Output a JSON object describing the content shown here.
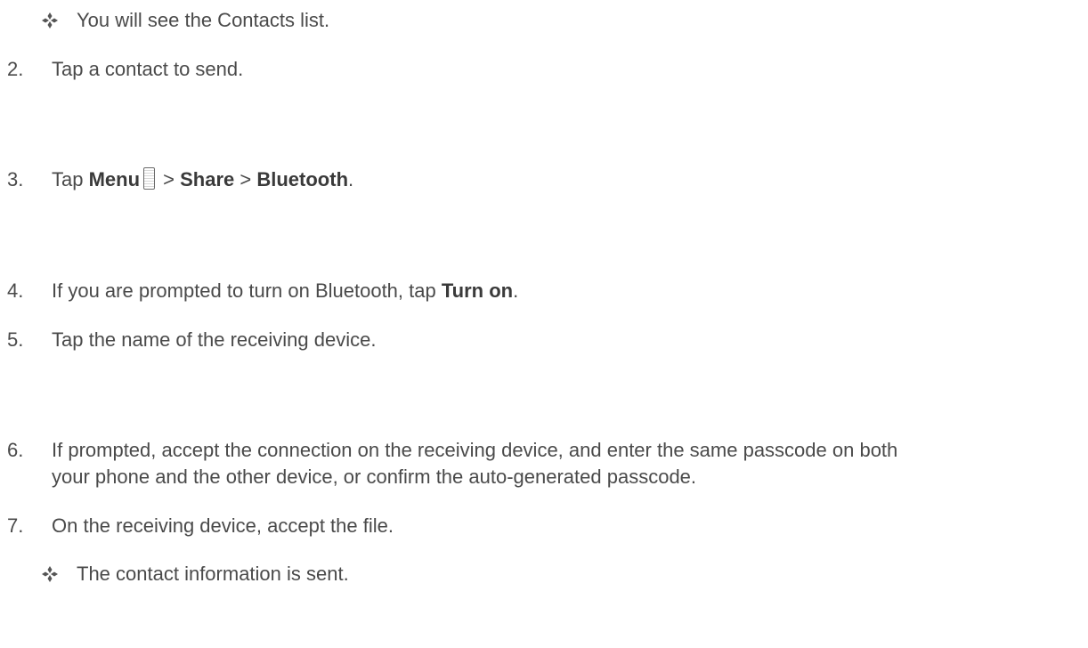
{
  "steps": {
    "sub_top": "You will see the Contacts list.",
    "s2": {
      "num": "2.",
      "text": "Tap a contact to send."
    },
    "s3": {
      "num": "3.",
      "tap": "Tap ",
      "menu": "Menu",
      "menu_icon": "phone-menu-icon",
      "sep1": " > ",
      "share": "Share",
      "sep2": " > ",
      "bluetooth": "Bluetooth",
      "end": "."
    },
    "s4": {
      "num": "4.",
      "text": "If you are prompted to turn on Bluetooth, tap ",
      "bold": "Turn on",
      "end": "."
    },
    "s5": {
      "num": "5.",
      "text": "Tap the name of the receiving device."
    },
    "s6": {
      "num": "6.",
      "line1": "If prompted, accept the connection on the receiving device, and enter the same passcode on both",
      "line2": "your phone and the other device, or confirm the auto-generated passcode."
    },
    "s7": {
      "num": "7.",
      "text": "On the receiving device, accept the file."
    },
    "sub_bottom": "The contact information is sent."
  }
}
